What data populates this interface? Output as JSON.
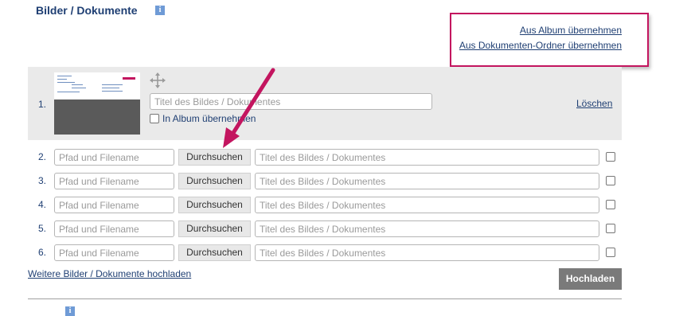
{
  "section": {
    "title": "Bilder / Dokumente",
    "info_badge": "i",
    "next_section_badge": "i"
  },
  "links": {
    "from_album": "Aus Album übernehmen",
    "from_documents_folder": "Aus Dokumenten-Ordner übernehmen",
    "upload_more": "Weitere Bilder / Dokumente hochladen"
  },
  "uploaded_item": {
    "number": "1.",
    "title_placeholder": "Titel des Bildes / Dokumentes",
    "in_album_label": "In Album übernehmen",
    "delete_label": "Löschen",
    "thumbnail_icon": "document-thumbnail",
    "move_icon": "move-arrows-icon"
  },
  "upload_rows": [
    {
      "number": "2.",
      "path_placeholder": "Pfad und Filename",
      "browse_label": "Durchsuchen",
      "title_placeholder": "Titel des Bildes / Dokumentes"
    },
    {
      "number": "3.",
      "path_placeholder": "Pfad und Filename",
      "browse_label": "Durchsuchen",
      "title_placeholder": "Titel des Bildes / Dokumentes"
    },
    {
      "number": "4.",
      "path_placeholder": "Pfad und Filename",
      "browse_label": "Durchsuchen",
      "title_placeholder": "Titel des Bildes / Dokumentes"
    },
    {
      "number": "5.",
      "path_placeholder": "Pfad und Filename",
      "browse_label": "Durchsuchen",
      "title_placeholder": "Titel des Bildes / Dokumentes"
    },
    {
      "number": "6.",
      "path_placeholder": "Pfad und Filename",
      "browse_label": "Durchsuchen",
      "title_placeholder": "Titel des Bildes / Dokumentes"
    }
  ],
  "buttons": {
    "upload": "Hochladen"
  },
  "colors": {
    "accent_magenta": "#c3155f",
    "link_navy": "#1f3f73",
    "row_gray": "#eaeaea",
    "button_gray": "#7a7a7a"
  }
}
